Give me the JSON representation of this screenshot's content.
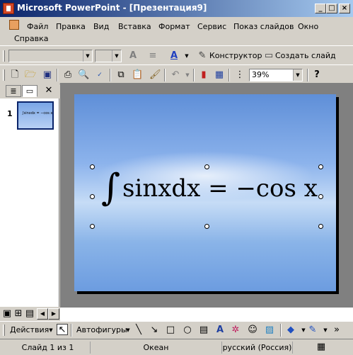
{
  "window": {
    "title": "Microsoft PowerPoint - [Презентация9]",
    "min_label": "_",
    "max_label": "□",
    "close_label": "×"
  },
  "menu": {
    "items": [
      "Файл",
      "Правка",
      "Вид",
      "Вставка",
      "Формат",
      "Сервис",
      "Показ слайдов",
      "Окно",
      "Справка"
    ]
  },
  "formatting_toolbar": {
    "designer_label": "Конструктор",
    "new_slide_label": "Создать слайд"
  },
  "standard_toolbar": {
    "zoom_value": "39%"
  },
  "outline_pane": {
    "slide_number": "1",
    "thumb_text": "∫sinxdx = −cos x"
  },
  "slide": {
    "integral": "∫",
    "expression": "sinxdx = −cos x"
  },
  "draw_toolbar": {
    "actions_label": "Действия",
    "autoshapes_label": "Автофигуры"
  },
  "statusbar": {
    "slide_info": "Слайд 1 из 1",
    "design": "Океан",
    "language": "русский (Россия)"
  },
  "colors": {
    "titlebar_start": "#0a246a",
    "titlebar_end": "#a6caf0",
    "chrome": "#d4d0c8",
    "workspace": "#808080"
  }
}
